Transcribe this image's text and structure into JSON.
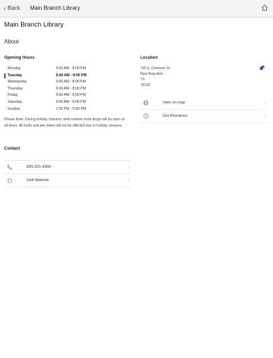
{
  "navbar": {
    "back_label": "Back",
    "title": "Main Branch Library"
  },
  "page": {
    "title": "Main Branch Library",
    "about_label": "About"
  },
  "hours": {
    "title": "Opening Hours",
    "rows": [
      {
        "day": "Monday",
        "time": "9:00 AM - 8:00 PM"
      },
      {
        "day": "Tuesday",
        "time": "9:00 AM - 8:00 PM"
      },
      {
        "day": "Wednesday",
        "time": "9:00 AM - 8:00 PM"
      },
      {
        "day": "Thursday",
        "time": "9:00 AM - 8:00 PM"
      },
      {
        "day": "Friday",
        "time": "9:00 AM - 6:00 PM"
      },
      {
        "day": "Saturday",
        "time": "9:00 AM - 6:00 PM"
      },
      {
        "day": "Sunday",
        "time": "1:00 PM - 5:00 PM"
      }
    ],
    "note": "Please Note: During holiday closures, both outdoor book drops will be open at all times. All holds and due dates will not be affected due to holiday closures."
  },
  "contact": {
    "title": "Contact",
    "phone": "830-221-4300",
    "website_label": "Visit Website"
  },
  "location": {
    "title": "Location",
    "address_lines": [
      "700 E. Common St",
      "New Braunfels",
      "TX",
      "78130"
    ],
    "view_map_label": "View on map",
    "directions_label": "Get Directions"
  },
  "colors": {
    "today_marker": "#1e6a33",
    "map_pin": "#2b3a8f"
  }
}
